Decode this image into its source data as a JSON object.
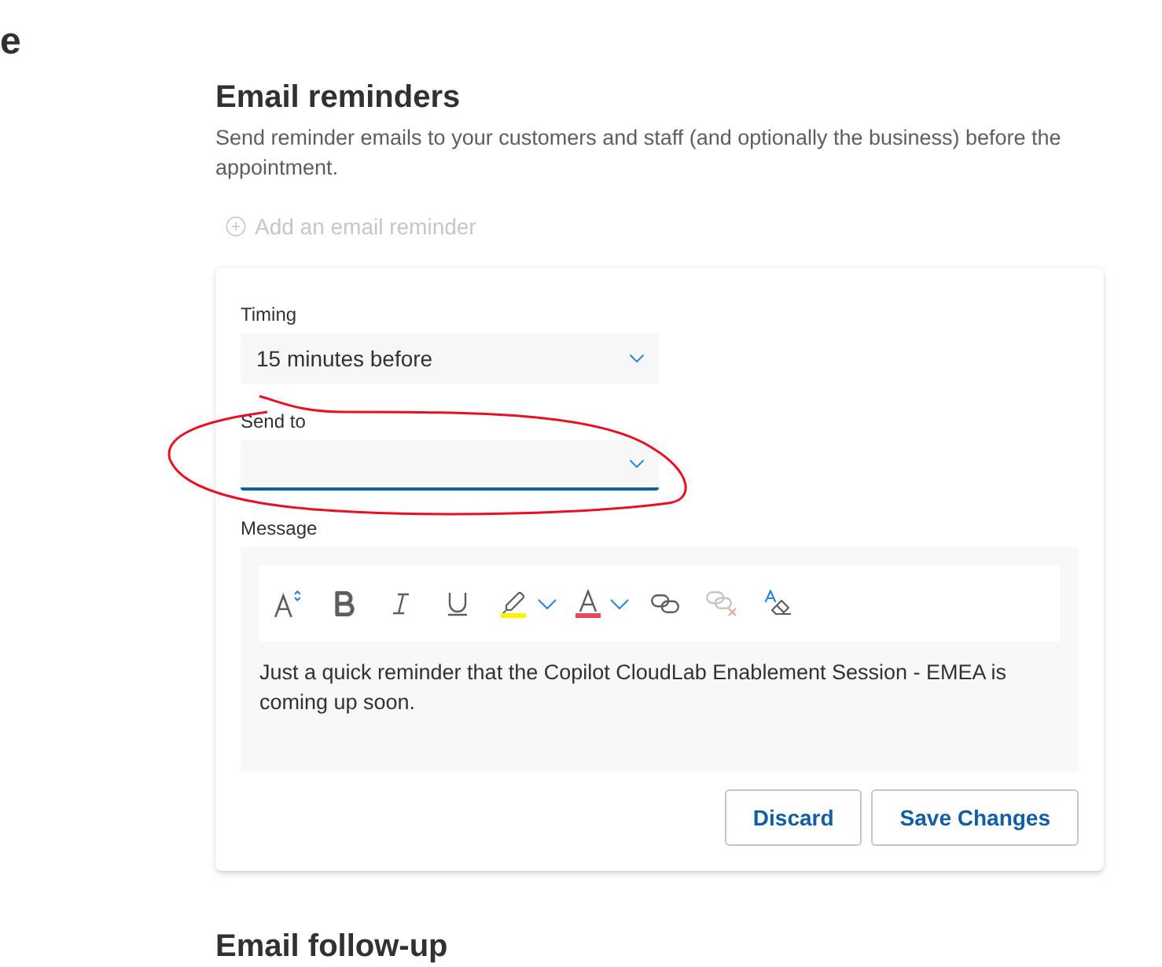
{
  "page_title_fragment": {
    "text": "e"
  },
  "email_reminders": {
    "title": "Email reminders",
    "description": "Send reminder emails to your customers and staff (and optionally the business) before the appointment.",
    "add_button": {
      "label": "Add an email reminder",
      "disabled": true
    },
    "card": {
      "fields": [
        {
          "kind": "dropdown",
          "label": "Timing",
          "value": "15 minutes before",
          "focused": false
        },
        {
          "kind": "dropdown",
          "label": "Send to",
          "focused": true
        }
      ],
      "message": {
        "label": "Message",
        "toolbar": [
          {
            "kind": "font-size",
            "disabled": false
          },
          {
            "kind": "bold",
            "disabled": false
          },
          {
            "kind": "italic",
            "disabled": false
          },
          {
            "kind": "underline",
            "disabled": false
          },
          {
            "kind": "highlight",
            "disabled": false
          },
          {
            "kind": "font-color",
            "disabled": false
          },
          {
            "kind": "link",
            "disabled": false
          },
          {
            "kind": "unlink",
            "disabled": true
          },
          {
            "kind": "clear-formatting",
            "disabled": false
          }
        ],
        "text": "Just a quick reminder that the Copilot CloudLab Enablement Session - EMEA is coming up soon."
      },
      "buttons": [
        {
          "label": "Discard"
        },
        {
          "label": "Save Changes"
        }
      ]
    }
  },
  "email_follow_up": {
    "title": "Email follow-up"
  }
}
